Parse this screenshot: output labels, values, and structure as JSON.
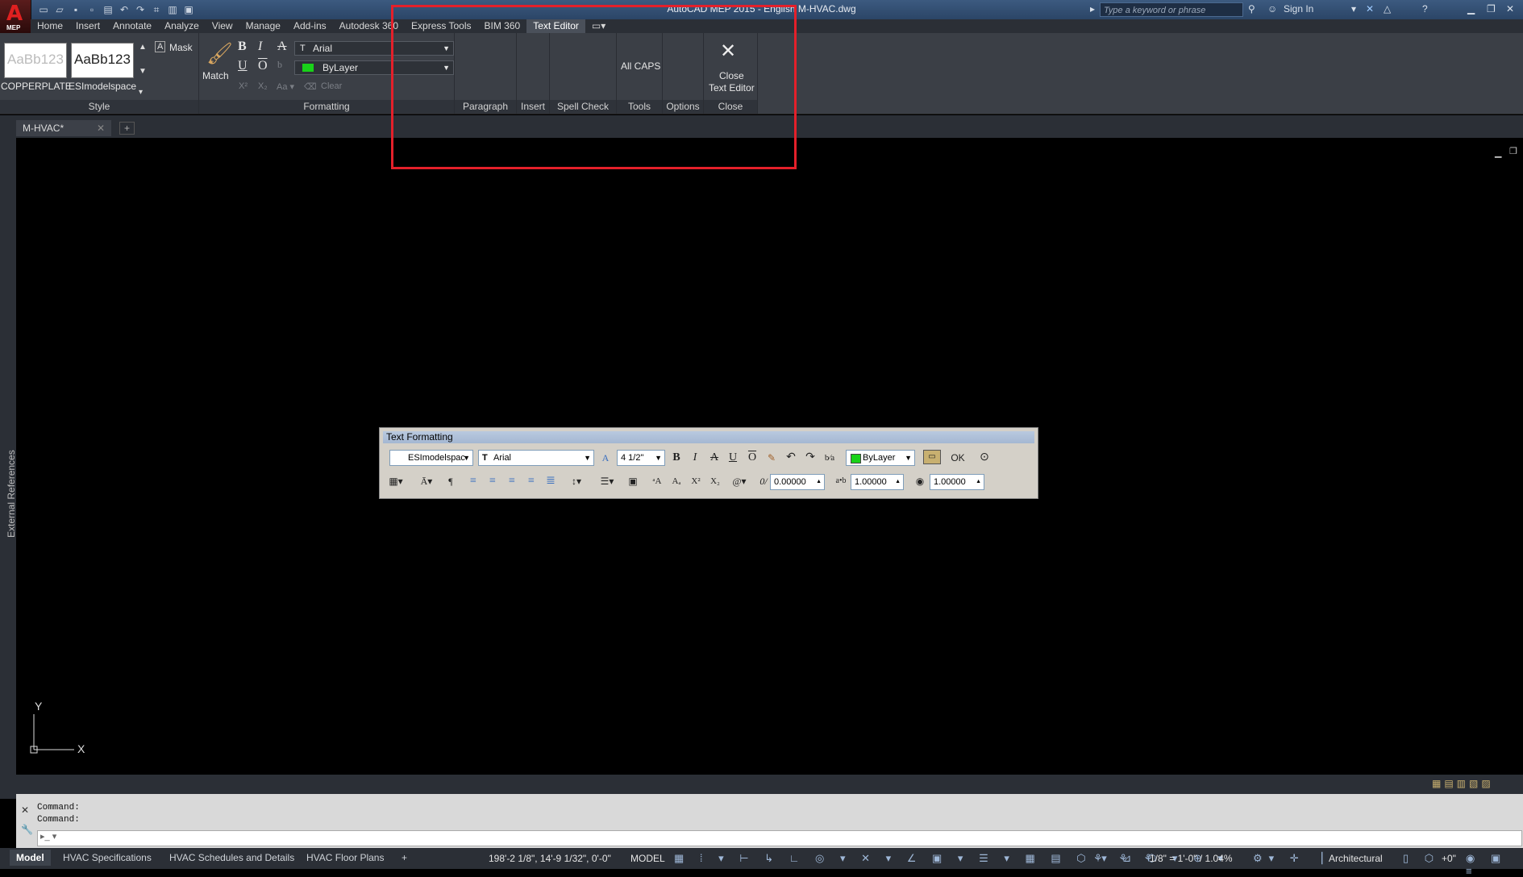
{
  "window": {
    "title": "AutoCAD MEP 2015 - English   M-HVAC.dwg",
    "app_label": "MEP",
    "search_placeholder": "Type a keyword or phrase",
    "sign_in": "Sign In"
  },
  "ribbon_tabs": [
    "Home",
    "Insert",
    "Annotate",
    "Analyze",
    "View",
    "Manage",
    "Add-ins",
    "Autodesk 360",
    "Express Tools",
    "BIM 360",
    "Text Editor"
  ],
  "active_tab": "Text Editor",
  "ribbon": {
    "style": {
      "samples": [
        {
          "preview": "AaBb123",
          "label": "COPPERPLATE"
        },
        {
          "preview": "AaBb123",
          "label": "ESImodelspace"
        }
      ],
      "mask_label": "Mask",
      "panel": "Style"
    },
    "formatting": {
      "match_label": "Match",
      "font": "Arial",
      "color": "ByLayer",
      "clear_label": "Clear",
      "panel": "Formatting"
    },
    "panels": {
      "paragraph": "Paragraph",
      "insert": "Insert",
      "spell_check": "Spell Check",
      "tools": "Tools",
      "options": "Options",
      "close": "Close"
    },
    "all_caps": "All CAPS",
    "close_text_editor": [
      "Close",
      "Text Editor"
    ]
  },
  "file_tab": "M-HVAC*",
  "side_palette": "External References",
  "axis": {
    "y": "Y",
    "x": "X"
  },
  "text_formatting": {
    "title": "Text Formatting",
    "style": "ESImodelspac",
    "font": "Arial",
    "height": "4 1/2\"",
    "color": "ByLayer",
    "ok": "OK",
    "oblique": "0.00000",
    "tracking": "1.00000",
    "width": "1.00000"
  },
  "command": {
    "lines": [
      "Command:",
      "Command:"
    ]
  },
  "layout_tabs": [
    "Model",
    "HVAC Specifications",
    "HVAC Schedules and Details",
    "HVAC Floor Plans"
  ],
  "status": {
    "coords": "198'-2 1/8\", 14'-9 1/32\", 0'-0\"",
    "space": "MODEL",
    "scale": "1/8\" = 1'-0\" / 1.04%",
    "units": "Architectural",
    "elevation": "+0\""
  },
  "colors": {
    "highlight": "#e4202a",
    "bylayer_swatch": "#19d219"
  }
}
